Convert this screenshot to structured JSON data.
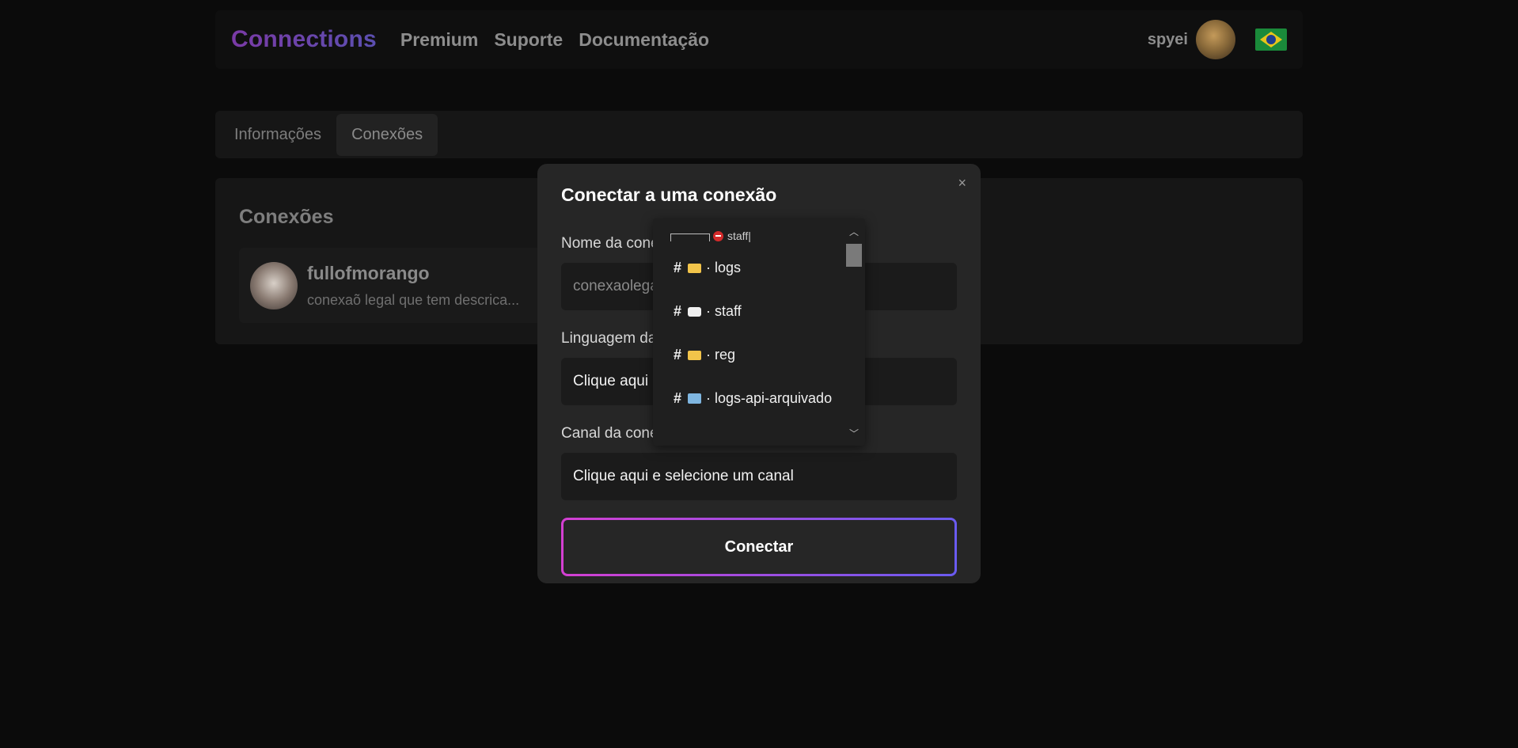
{
  "navbar": {
    "brand": "Connections",
    "links": [
      "Premium",
      "Suporte",
      "Documentação"
    ],
    "username": "spyei",
    "flag_icon": "brazil-flag-icon"
  },
  "tabs": [
    {
      "label": "Informações",
      "active": false
    },
    {
      "label": "Conexões",
      "active": true
    }
  ],
  "panel": {
    "title": "Conexões",
    "connection": {
      "name": "fullofmorango",
      "description": "conexaõ legal que tem descrica..."
    }
  },
  "modal": {
    "title": "Conectar a uma conexão",
    "close_icon": "×",
    "name_label": "Nome da conexão",
    "name_value": "conexaolegal",
    "language_label": "Linguagem da conexão",
    "language_value": "Clique aqui e selecione uma linguagem",
    "channel_label": "Canal da conexão",
    "channel_value": "Clique aqui e selecione um canal",
    "connect_label": "Conectar"
  },
  "dropdown": {
    "category": "staff|",
    "items": [
      {
        "icon": "folder-icon",
        "label": "· logs"
      },
      {
        "icon": "speech-bubble-icon",
        "label": "· staff"
      },
      {
        "icon": "folder-icon",
        "label": "· reg"
      },
      {
        "icon": "inbox-icon",
        "label": "· logs-api-arquivado"
      }
    ]
  },
  "colors": {
    "accent_start": "#d43fd2",
    "accent_end": "#6a5bf0",
    "brand": "#7a3aa6"
  }
}
